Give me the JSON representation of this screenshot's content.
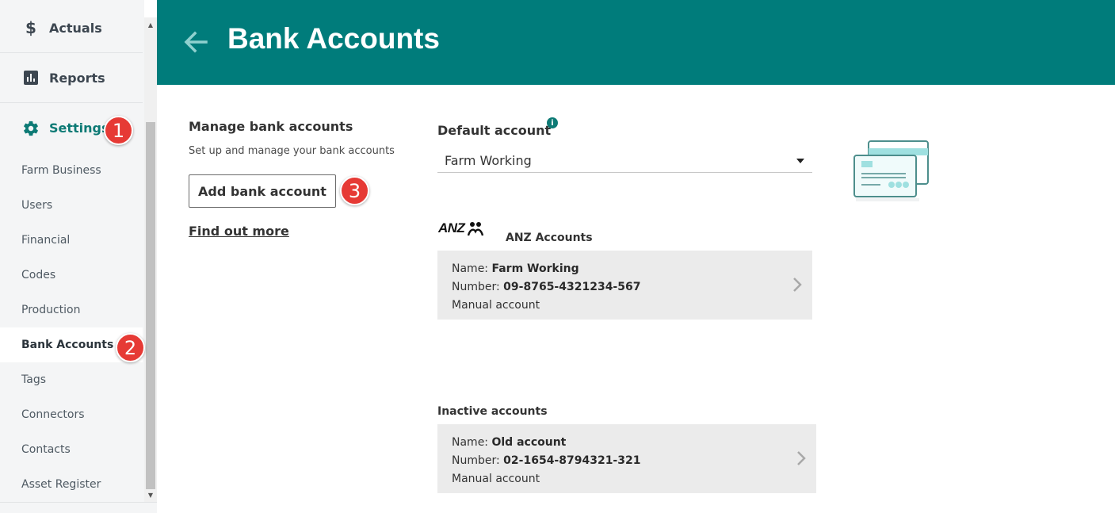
{
  "sidebar": {
    "main_items": [
      {
        "label": "Actuals",
        "icon": "dollar-icon"
      },
      {
        "label": "Reports",
        "icon": "bar-chart-icon"
      },
      {
        "label": "Settings",
        "icon": "gear-icon"
      }
    ],
    "sub_items": [
      "Farm Business",
      "Users",
      "Financial",
      "Codes",
      "Production",
      "Bank Accounts",
      "Tags",
      "Connectors",
      "Contacts",
      "Asset Register"
    ],
    "active_sub_item": "Bank Accounts"
  },
  "badges": [
    "1",
    "2",
    "3"
  ],
  "header": {
    "title": "Bank Accounts",
    "back_icon": "arrow-left-icon",
    "color": "#007c7b"
  },
  "manage": {
    "title": "Manage bank accounts",
    "description": "Set up and manage your bank accounts",
    "add_button": "Add bank account",
    "find_out_more": "Find out more"
  },
  "default_account": {
    "label": "Default account",
    "info_glyph": "i",
    "selected": "Farm Working"
  },
  "bank_groups": [
    {
      "bank_logo_text": "ANZ",
      "heading": "ANZ Accounts",
      "accounts": [
        {
          "name_label": "Name:",
          "name": "Farm Working",
          "number_label": "Number:",
          "number": "09-8765-4321234-567",
          "type": "Manual account"
        }
      ]
    }
  ],
  "inactive": {
    "heading": "Inactive accounts",
    "accounts": [
      {
        "name_label": "Name:",
        "name": "Old account",
        "number_label": "Number:",
        "number": "02-1654-8794321-321",
        "type": "Manual account"
      }
    ]
  },
  "colors": {
    "accent": "#007c7b",
    "badge": "#e63a35",
    "card_bg": "#ebebeb"
  }
}
